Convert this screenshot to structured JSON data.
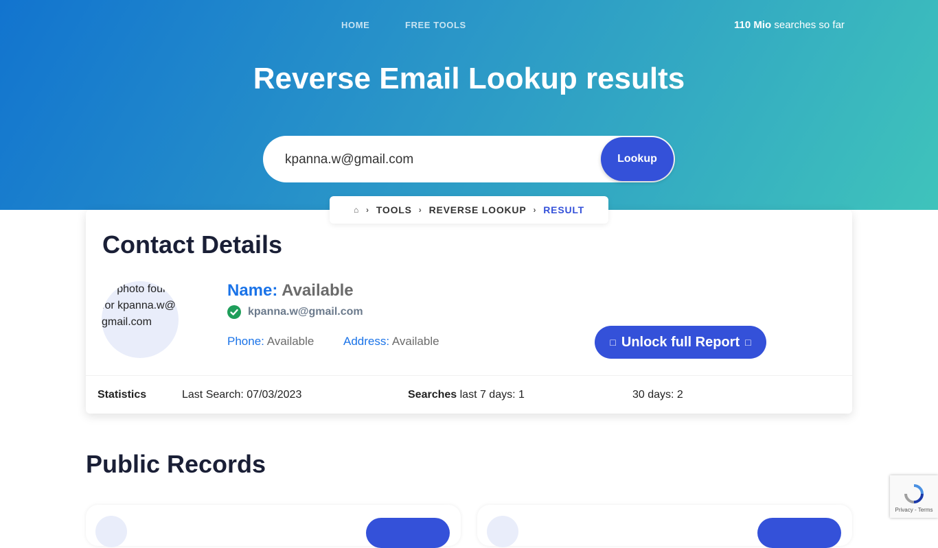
{
  "nav": {
    "home": "HOME",
    "free_tools": "FREE TOOLS",
    "counter_strong": "110 Mio",
    "counter_rest": " searches so far"
  },
  "hero": {
    "title": "Reverse Email Lookup results"
  },
  "search": {
    "value": "kpanna.w@gmail.com",
    "button": "Lookup"
  },
  "breadcrumb": {
    "home_icon": "home-icon",
    "items": [
      "TOOLS",
      "REVERSE LOOKUP",
      "RESULT"
    ]
  },
  "contact": {
    "title": "Contact Details",
    "photo_alt": "no photo found for kpanna.w@gmail.com",
    "name_label": "Name:",
    "name_value": "Available",
    "email": "kpanna.w@gmail.com",
    "phone_label": "Phone:",
    "phone_value": "Available",
    "address_label": "Address:",
    "address_value": "Available",
    "unlock_button": "Unlock full Report"
  },
  "stats": {
    "label": "Statistics",
    "last_search": "Last Search: 07/03/2023",
    "searches_strong": "Searches",
    "searches_rest": " last 7 days: 1",
    "thirty_days": "30 days: 2"
  },
  "public_records": {
    "title": "Public Records"
  },
  "recaptcha": {
    "links": "Privacy - Terms"
  },
  "colors": {
    "accent": "#3451d9",
    "link_blue": "#1a73e8",
    "verified_green": "#1e9e5a"
  }
}
